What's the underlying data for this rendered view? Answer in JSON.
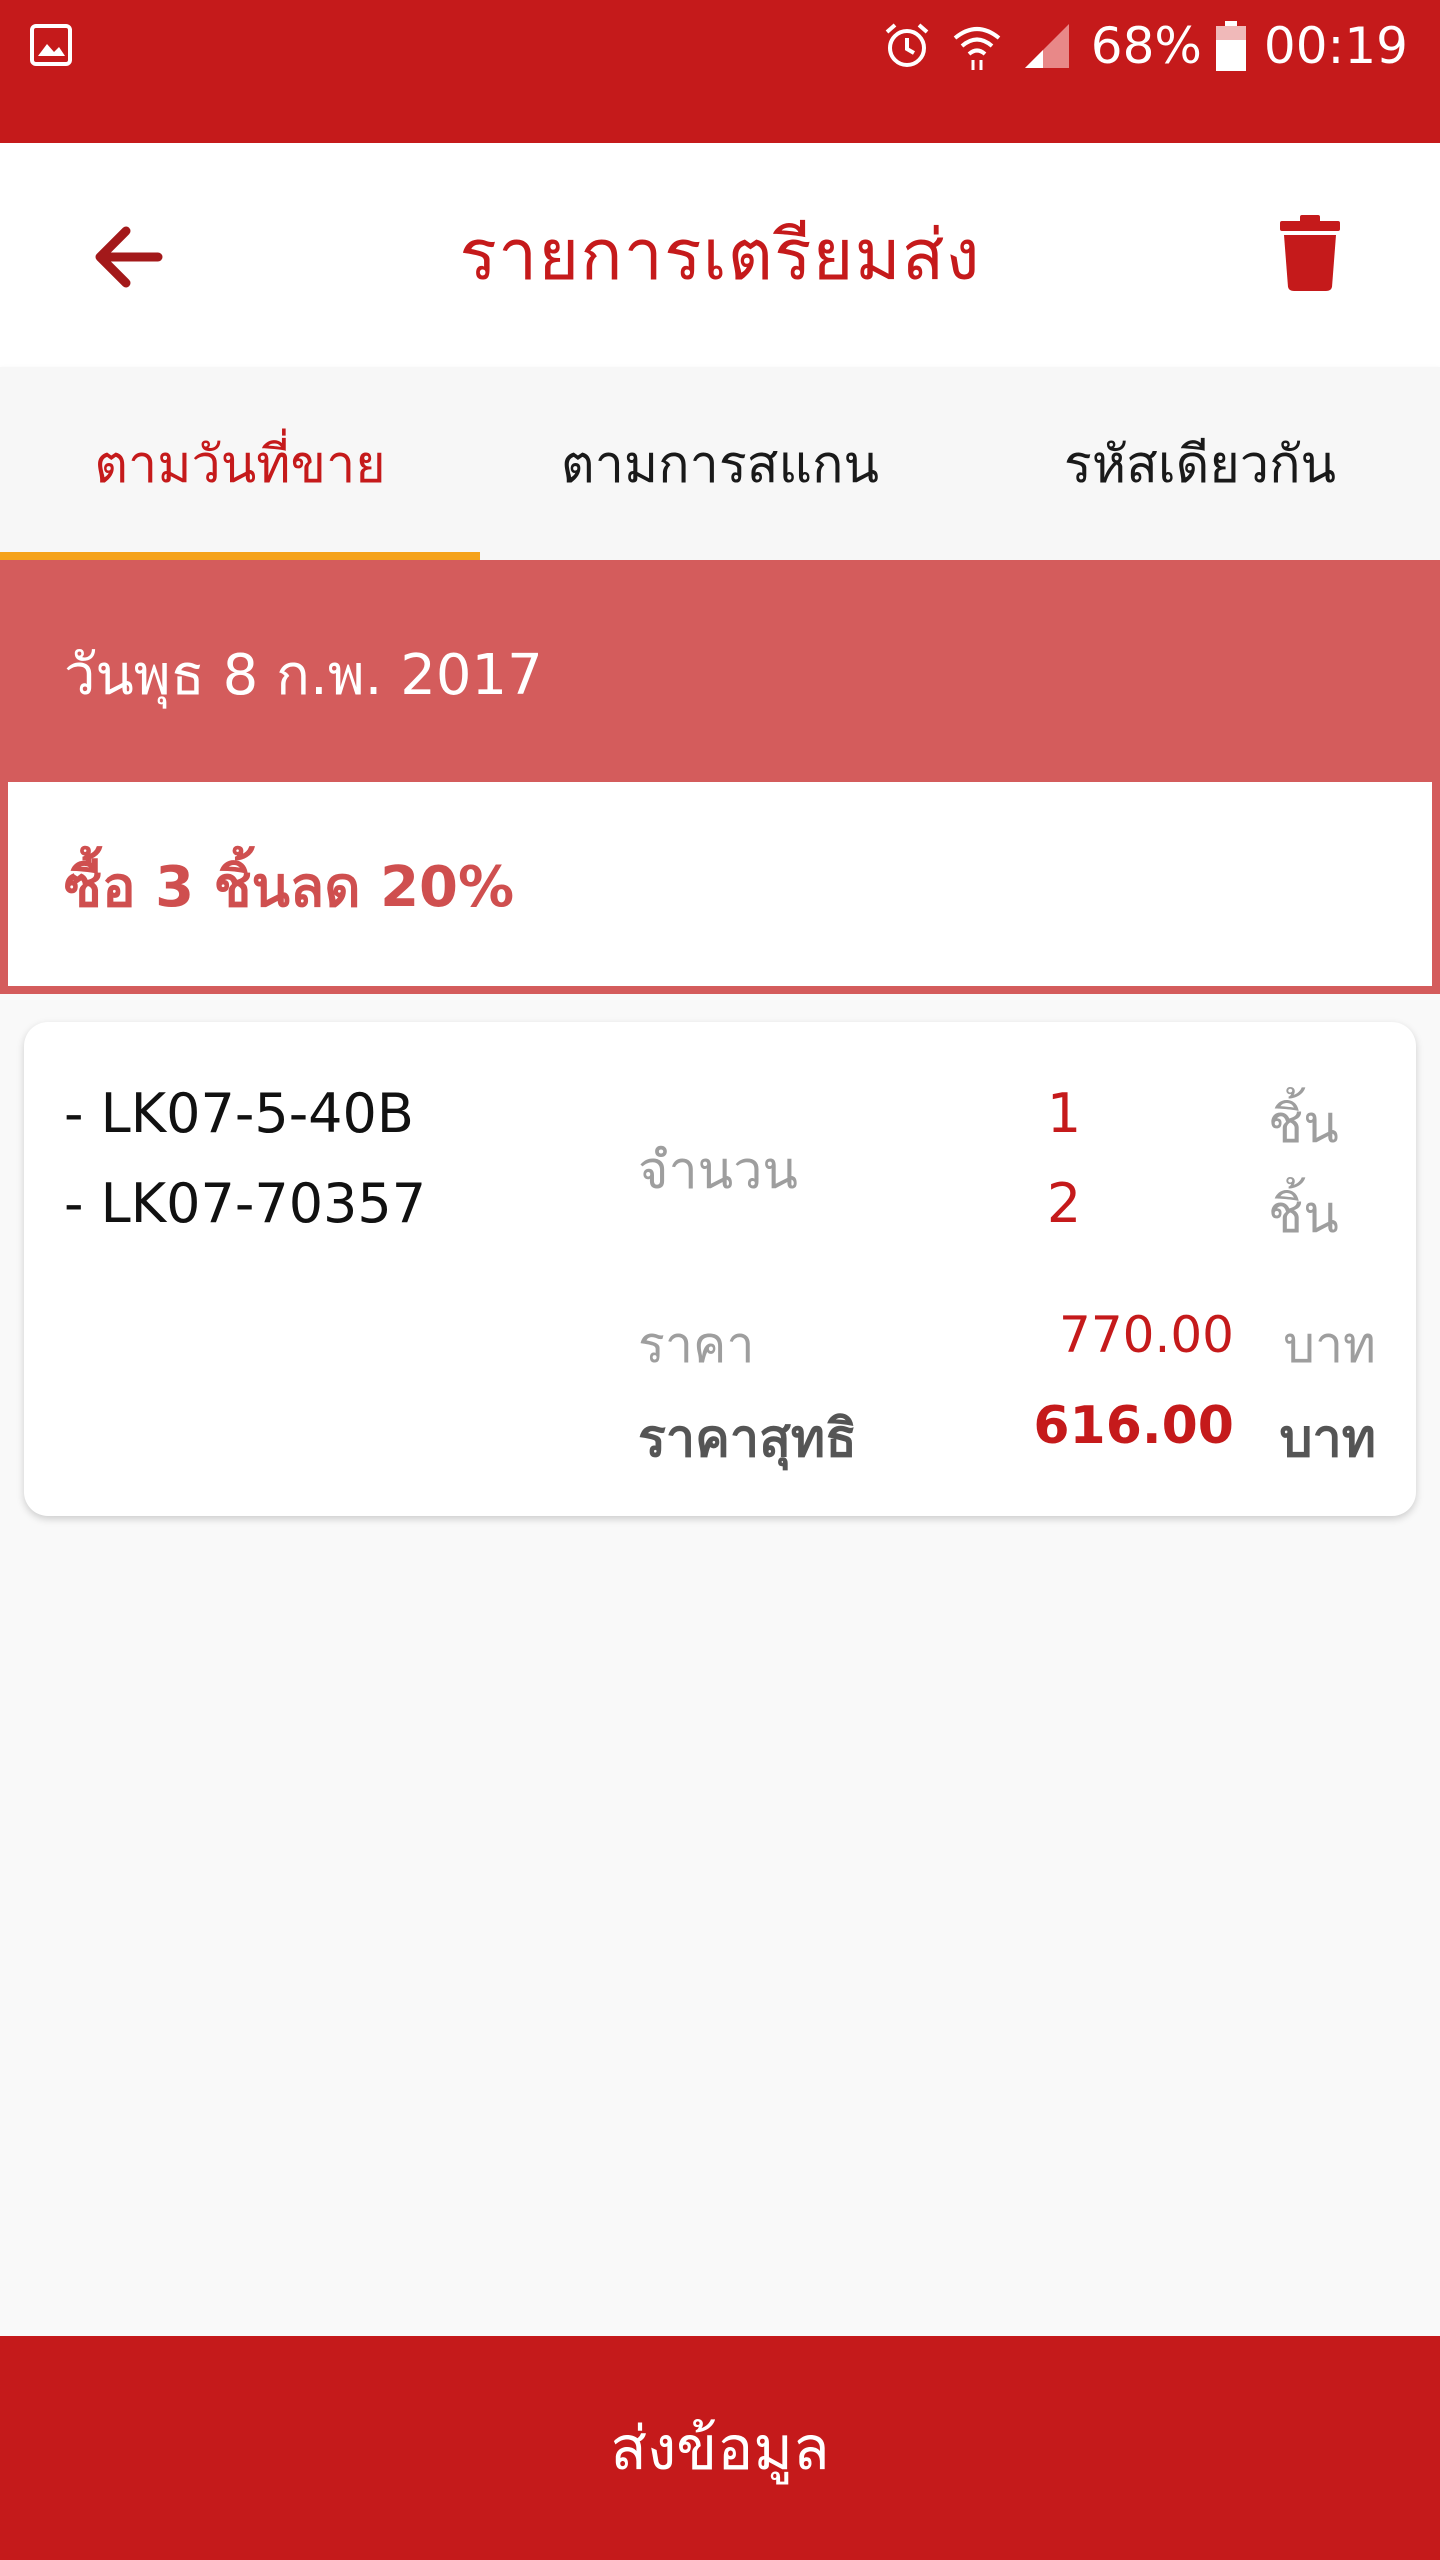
{
  "status_bar": {
    "battery_percent": "68%",
    "time": "00:19",
    "icons": [
      "gallery-icon",
      "alarm-icon",
      "wifi-icon",
      "signal-icon",
      "battery-icon"
    ]
  },
  "header": {
    "title": "รายการเตรียมส่ง",
    "back_icon": "back-arrow-icon",
    "delete_icon": "trash-icon"
  },
  "tabs": [
    {
      "label": "ตามวันที่ขาย",
      "active": true
    },
    {
      "label": "ตามการสแกน",
      "active": false
    },
    {
      "label": "รหัสเดียวกัน",
      "active": false
    }
  ],
  "date_group": {
    "date": "วันพุธ 8 ก.พ. 2017"
  },
  "promotion": {
    "title": "ซื้อ 3 ชิ้นลด 20%"
  },
  "item_card": {
    "items": [
      {
        "code": "- LK07-5-40B",
        "qty": "1",
        "unit": "ชิ้น"
      },
      {
        "code": "- LK07-70357",
        "qty": "2",
        "unit": "ชิ้น"
      }
    ],
    "qty_label": "จำนวน",
    "price_label": "ราคา",
    "price_value": "770.00",
    "price_unit": "บาท",
    "net_label": "ราคาสุทธิ",
    "net_value": "616.00",
    "net_unit": "บาท"
  },
  "footer": {
    "submit_label": "ส่งข้อมูล"
  },
  "colors": {
    "primary": "#c51a1b",
    "date_band": "#d45c5c",
    "tab_indicator": "#f5a21b"
  }
}
